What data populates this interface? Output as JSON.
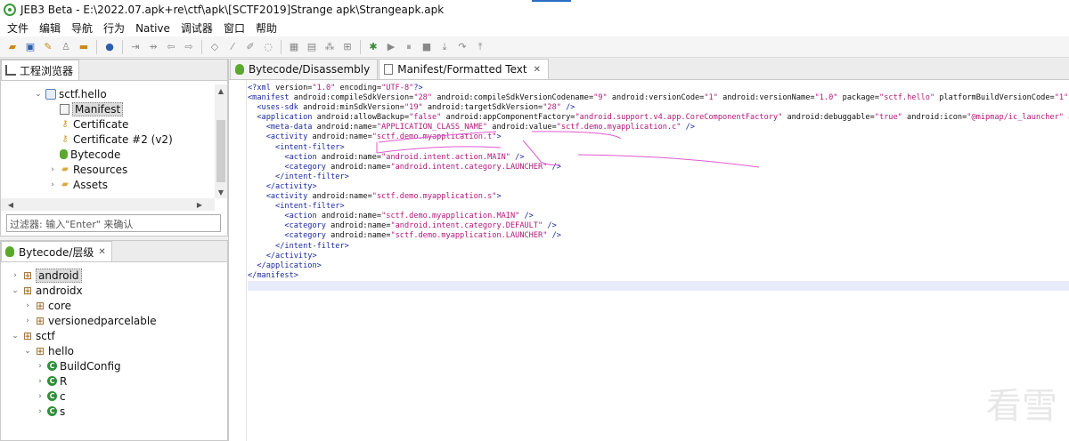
{
  "window": {
    "title": "JEB3 Beta - E:\\2022.07.apk+re\\ctf\\apk\\[SCTF2019]Strange apk\\Strangeapk.apk"
  },
  "menu": [
    "文件",
    "编辑",
    "导航",
    "行为",
    "Native",
    "调试器",
    "窗口",
    "帮助"
  ],
  "project_panel": {
    "tab_label": "工程浏览器",
    "items": [
      {
        "label": "sctf.hello",
        "indent": 0,
        "arrow": "⌄",
        "icon": "project-icon"
      },
      {
        "label": "Manifest",
        "indent": 1,
        "arrow": "",
        "icon": "manifest-icon",
        "selected": true
      },
      {
        "label": "Certificate",
        "indent": 1,
        "arrow": "",
        "icon": "key-icon"
      },
      {
        "label": "Certificate #2 (v2)",
        "indent": 1,
        "arrow": "",
        "icon": "key-icon"
      },
      {
        "label": "Bytecode",
        "indent": 1,
        "arrow": "",
        "icon": "bug-icon"
      },
      {
        "label": "Resources",
        "indent": 1,
        "arrow": "›",
        "icon": "folder-icon"
      },
      {
        "label": "Assets",
        "indent": 1,
        "arrow": "›",
        "icon": "folder-icon"
      }
    ],
    "filter_placeholder": "过滤器: 输入\"Enter\" 来确认"
  },
  "hierarchy_panel": {
    "tab_label": "Bytecode/层级",
    "items": [
      {
        "label": "android",
        "indent": 0,
        "arrow": "›",
        "icon": "package-icon",
        "selected": true
      },
      {
        "label": "androidx",
        "indent": 0,
        "arrow": "⌄",
        "icon": "package-icon"
      },
      {
        "label": "core",
        "indent": 1,
        "arrow": "›",
        "icon": "package-icon"
      },
      {
        "label": "versionedparcelable",
        "indent": 1,
        "arrow": "›",
        "icon": "package-icon"
      },
      {
        "label": "sctf",
        "indent": 0,
        "arrow": "⌄",
        "icon": "package-icon"
      },
      {
        "label": "hello",
        "indent": 1,
        "arrow": "⌄",
        "icon": "package-icon"
      },
      {
        "label": "BuildConfig",
        "indent": 2,
        "arrow": "›",
        "icon": "class-icon"
      },
      {
        "label": "R",
        "indent": 2,
        "arrow": "›",
        "icon": "class-icon"
      },
      {
        "label": "c",
        "indent": 2,
        "arrow": "›",
        "icon": "class-icon"
      },
      {
        "label": "s",
        "indent": 2,
        "arrow": "›",
        "icon": "class-icon"
      }
    ]
  },
  "editor": {
    "tabs": [
      {
        "label": "Bytecode/Disassembly",
        "active": false
      },
      {
        "label": "Manifest/Formatted Text",
        "active": true
      }
    ],
    "lines": [
      "<?xml version=\"1.0\" encoding=\"UTF-8\"?>",
      "<manifest android:compileSdkVersion=\"28\" android:compileSdkVersionCodename=\"9\" android:versionCode=\"1\" android:versionName=\"1.0\" package=\"sctf.hello\" platformBuildVersionCode=\"1\"",
      "  <uses-sdk android:minSdkVersion=\"19\" android:targetSdkVersion=\"28\" />",
      "  <application android:allowBackup=\"false\" android:appComponentFactory=\"android.support.v4.app.CoreComponentFactory\" android:debuggable=\"true\" android:icon=\"@mipmap/ic_launcher\" a",
      "    <meta-data android:name=\"APPLICATION_CLASS_NAME\" android:value=\"sctf.demo.myapplication.c\" />",
      "    <activity android:name=\"sctf.demo.myapplication.t\">",
      "      <intent-filter>",
      "        <action android:name=\"android.intent.action.MAIN\" />",
      "        <category android:name=\"android.intent.category.LAUNCHER\" />",
      "      </intent-filter>",
      "    </activity>",
      "    <activity android:name=\"sctf.demo.myapplication.s\">",
      "      <intent-filter>",
      "        <action android:name=\"sctf.demo.myapplication.MAIN\" />",
      "        <category android:name=\"android.intent.category.DEFAULT\" />",
      "        <category android:name=\"sctf.demo.myapplication.LAUNCHER\" />",
      "      </intent-filter>",
      "    </activity>",
      "  </application>",
      "</manifest>"
    ],
    "current_line": 20
  },
  "watermark": {
    "text": "看雪"
  },
  "colors": {
    "tag": "#1a2a9e",
    "value": "#b0187a",
    "annotation": "#e05ad0",
    "bytecode_green": "#5aa82e"
  }
}
